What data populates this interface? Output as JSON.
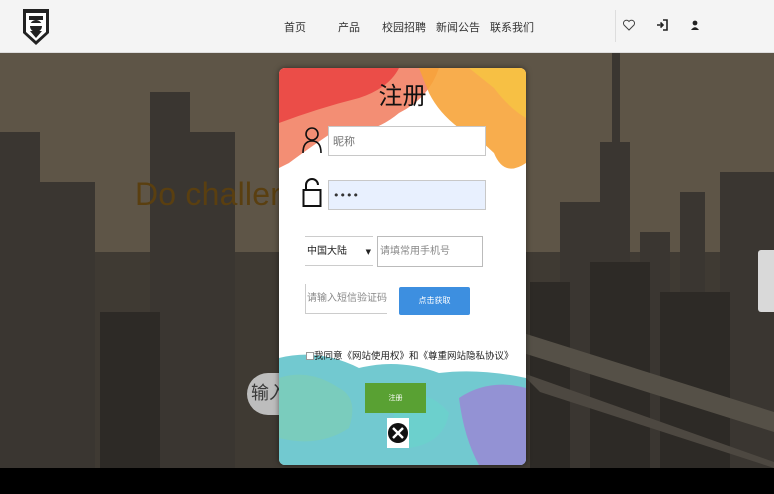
{
  "nav": {
    "items": [
      "首页",
      "产品",
      "校园招聘",
      "新闻公告",
      "联系我们"
    ],
    "icons": [
      "heart-icon",
      "sign-in-icon",
      "user-icon"
    ]
  },
  "background": {
    "headline": "Do challeng                                 od people",
    "search_fragment": "输入"
  },
  "modal": {
    "title": "注册",
    "nickname_placeholder": "昵称",
    "password_value": "••••",
    "region": "中国大陆",
    "phone_placeholder": "请填常用手机号",
    "code_placeholder": "请输入短信验证码",
    "get_code_label": "点击获取",
    "agreement_text": "我同意《网站使用权》和《尊重网站隐私协议》",
    "register_label": "注册",
    "colors": {
      "get_code": "#3d8fe0",
      "register": "#59a133"
    }
  }
}
